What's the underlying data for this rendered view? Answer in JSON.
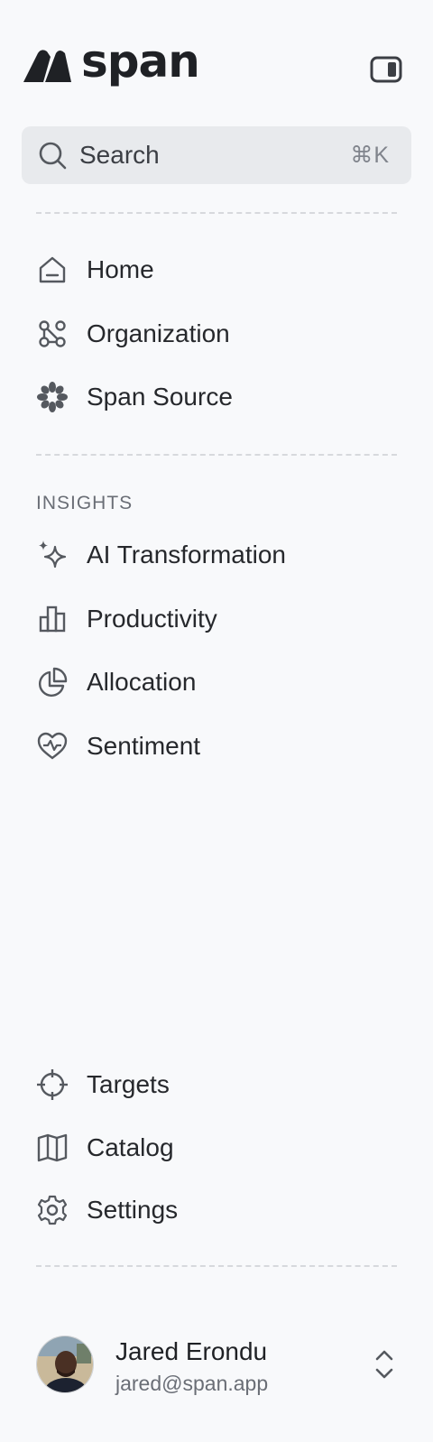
{
  "app": {
    "name": "span"
  },
  "search": {
    "label": "Search",
    "shortcut": "⌘K"
  },
  "nav_primary": [
    {
      "label": "Home",
      "icon": "home-icon"
    },
    {
      "label": "Organization",
      "icon": "organization-icon"
    },
    {
      "label": "Span Source",
      "icon": "span-source-icon"
    }
  ],
  "insights": {
    "title": "INSIGHTS",
    "items": [
      {
        "label": "AI Transformation",
        "icon": "sparkles-icon"
      },
      {
        "label": "Productivity",
        "icon": "bar-chart-icon"
      },
      {
        "label": "Allocation",
        "icon": "pie-chart-icon"
      },
      {
        "label": "Sentiment",
        "icon": "heart-pulse-icon"
      }
    ]
  },
  "nav_bottom": [
    {
      "label": "Targets",
      "icon": "crosshair-icon"
    },
    {
      "label": "Catalog",
      "icon": "book-open-icon"
    },
    {
      "label": "Settings",
      "icon": "gear-icon"
    }
  ],
  "user": {
    "name": "Jared Erondu",
    "email": "jared@span.app"
  },
  "colors": {
    "background": "#f8f9fb",
    "search_bg": "#e8eaed",
    "text": "#26282c",
    "muted": "#6a6e76",
    "icon": "#55595f"
  }
}
